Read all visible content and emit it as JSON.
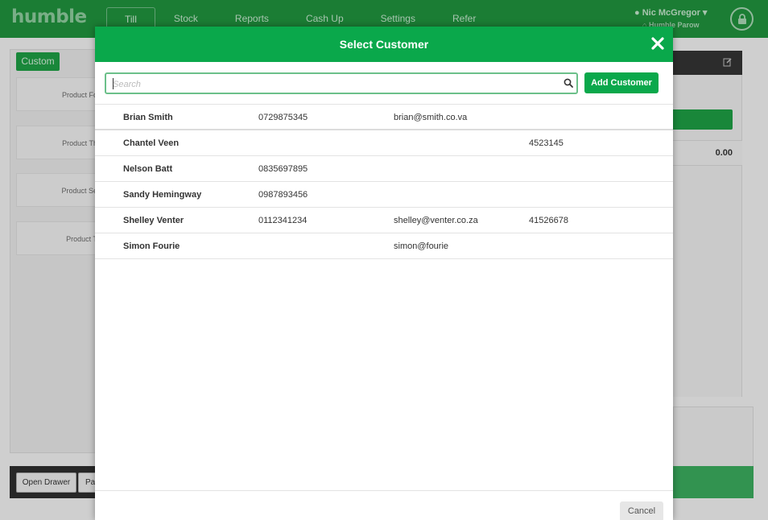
{
  "app": {
    "logo": "humble",
    "nav": [
      "Till",
      "Stock",
      "Reports",
      "Cash Up",
      "Settings",
      "Refer"
    ],
    "active_nav": "Till",
    "user_name": "Nic McGregor",
    "store_name": "Humble Parow"
  },
  "background": {
    "tab_label": "Custom",
    "product_tiles": [
      "Product Fo",
      "Product Th",
      "Product Se",
      "Product T"
    ],
    "open_drawer_label": "Open Drawer",
    "pay_label": "Pay",
    "total": "0.00"
  },
  "modal": {
    "title": "Select Customer",
    "search_placeholder": "Search",
    "search_value": "",
    "add_label": "Add Customer",
    "cancel_label": "Cancel",
    "customers": [
      {
        "name": "Brian Smith",
        "phone": "0729875345",
        "email": "brian@smith.co.va",
        "other": ""
      },
      {
        "name": "Chantel Veen",
        "phone": "",
        "email": "",
        "other": "4523145"
      },
      {
        "name": "Nelson Batt",
        "phone": "0835697895",
        "email": "",
        "other": ""
      },
      {
        "name": "Sandy Hemingway",
        "phone": "0987893456",
        "email": "",
        "other": ""
      },
      {
        "name": "Shelley Venter",
        "phone": "0112341234",
        "email": "shelley@venter.co.za",
        "other": "41526678"
      },
      {
        "name": "Simon Fourie",
        "phone": "",
        "email": "simon@fourie",
        "other": ""
      }
    ]
  },
  "colors": {
    "brand_green": "#0aa84b",
    "nav_green": "#1f8f3c"
  }
}
